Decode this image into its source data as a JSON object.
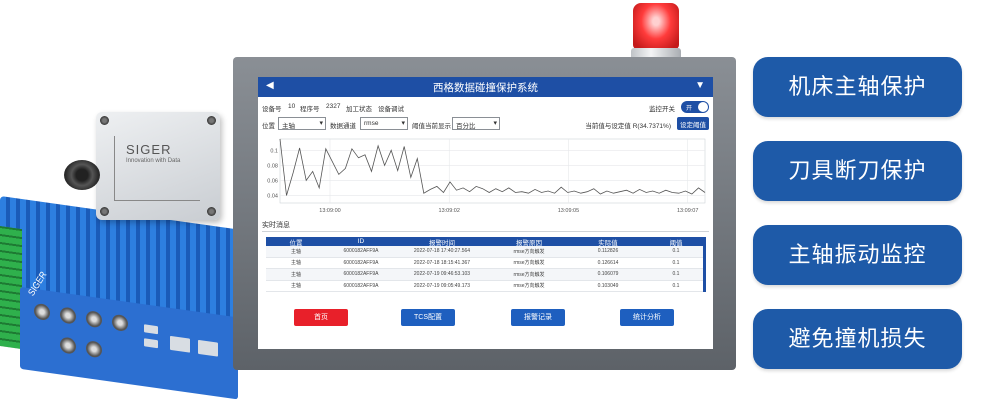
{
  "hardware": {
    "sensor_brand": "SIGER",
    "sensor_slogan": "Innovation with Data",
    "controller_brand": "SIGER"
  },
  "app": {
    "title": "西格数据碰撞保护系统"
  },
  "info_row": {
    "device_label": "设备号",
    "device_value": "10",
    "program_label": "程序号",
    "program_value": "2327",
    "state_label": "加工状态",
    "state_value": "设备调试",
    "monitor_switch_label": "监控开关",
    "monitor_switch_state": "开"
  },
  "filter_row": {
    "position_label": "位置",
    "position_value": "主轴",
    "channel_label": "数据通道",
    "channel_value": "rmse",
    "threshold_display_label": "阈值当前显示",
    "threshold_display_value": "百分比",
    "ratio_text": "当前值与设定值 R(34.7371%)",
    "set_threshold_button": "设定阈值"
  },
  "chart_data": {
    "type": "line",
    "y_ticks": [
      "0.1",
      "0.08",
      "0.06",
      "0.04"
    ],
    "x_ticks": [
      "13:09:00",
      "13:09:02",
      "13:09:05",
      "13:09:07"
    ],
    "ylim": [
      0.03,
      0.115
    ],
    "grid": true,
    "values": [
      0.118,
      0.04,
      0.07,
      0.103,
      0.06,
      0.072,
      0.05,
      0.102,
      0.085,
      0.068,
      0.076,
      0.102,
      0.09,
      0.094,
      0.072,
      0.106,
      0.08,
      0.1,
      0.073,
      0.105,
      0.064,
      0.089,
      0.043,
      0.048,
      0.052,
      0.044,
      0.058,
      0.047,
      0.05,
      0.045,
      0.052,
      0.049,
      0.044,
      0.049,
      0.045,
      0.05,
      0.044,
      0.045,
      0.043,
      0.048,
      0.044,
      0.046,
      0.043,
      0.051,
      0.044,
      0.046,
      0.043,
      0.045,
      0.049,
      0.042,
      0.046,
      0.043,
      0.045,
      0.047,
      0.043,
      0.048,
      0.044,
      0.046,
      0.043,
      0.047,
      0.044,
      0.043,
      0.046,
      0.042,
      0.05,
      0.044
    ]
  },
  "realtime": {
    "title": "实时消息",
    "columns": [
      "位置",
      "ID",
      "报警时间",
      "报警原因",
      "实际值",
      "阈值"
    ],
    "rows": [
      [
        "主轴",
        "6000182AFF9A",
        "2022-07-18 17:40:27.564",
        "rmse方向触发",
        "0.112826",
        "0.1"
      ],
      [
        "主轴",
        "6000182AFF9A",
        "2022-07-18 18:15:41.367",
        "rmse方向触发",
        "0.126614",
        "0.1"
      ],
      [
        "主轴",
        "6000182AFF9A",
        "2022-07-19 09:46:53.103",
        "rmse方向触发",
        "0.106079",
        "0.1"
      ],
      [
        "主轴",
        "6000182AFF9A",
        "2022-07-19 09:05:49.173",
        "rmse方向触发",
        "0.103049",
        "0.1"
      ]
    ]
  },
  "nav": {
    "home": "首页",
    "tcs_config": "TCS配置",
    "alarm_log": "报警记录",
    "statistics": "统计分析"
  },
  "features": [
    "机床主轴保护",
    "刀具断刀保护",
    "主轴振动监控",
    "避免撞机损失"
  ],
  "colors": {
    "accent": "#1e4fa5",
    "pill": "#1e5aa8",
    "danger": "#e8202a"
  }
}
